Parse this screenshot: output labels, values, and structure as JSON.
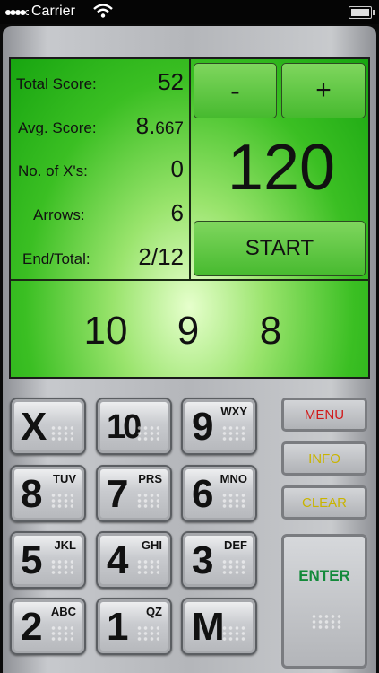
{
  "status_bar": {
    "carrier": "Carrier"
  },
  "stats": [
    {
      "label": "Total Score:",
      "value": "52",
      "value_suffix": ""
    },
    {
      "label": "Avg. Score:",
      "value": "8.",
      "value_suffix": "667"
    },
    {
      "label": "No.  of  X's:",
      "value": "0",
      "value_suffix": ""
    },
    {
      "label": "Arrows:",
      "value": "6",
      "value_suffix": ""
    },
    {
      "label": "End/Total:",
      "value": "2/12",
      "value_suffix": ""
    }
  ],
  "timer": {
    "minus_label": "-",
    "plus_label": "+",
    "value": "120",
    "start_label": "START"
  },
  "arrows": [
    "10",
    "9",
    "8"
  ],
  "keypad": [
    {
      "key": "X",
      "letters": ""
    },
    {
      "key": "10",
      "letters": ""
    },
    {
      "key": "9",
      "letters": "WXY"
    },
    {
      "key": "8",
      "letters": "TUV"
    },
    {
      "key": "7",
      "letters": "PRS"
    },
    {
      "key": "6",
      "letters": "MNO"
    },
    {
      "key": "5",
      "letters": "JKL"
    },
    {
      "key": "4",
      "letters": "GHI"
    },
    {
      "key": "3",
      "letters": "DEF"
    },
    {
      "key": "2",
      "letters": "ABC"
    },
    {
      "key": "1",
      "letters": "QZ"
    },
    {
      "key": "M",
      "letters": ""
    }
  ],
  "side_buttons": {
    "menu": {
      "label": "MENU",
      "color": "#d11a1a"
    },
    "info": {
      "label": "INFO",
      "color": "#c9b400"
    },
    "clear": {
      "label": "CLEAR",
      "color": "#c9b400"
    },
    "enter": {
      "label": "ENTER",
      "color": "#138a3a"
    }
  }
}
